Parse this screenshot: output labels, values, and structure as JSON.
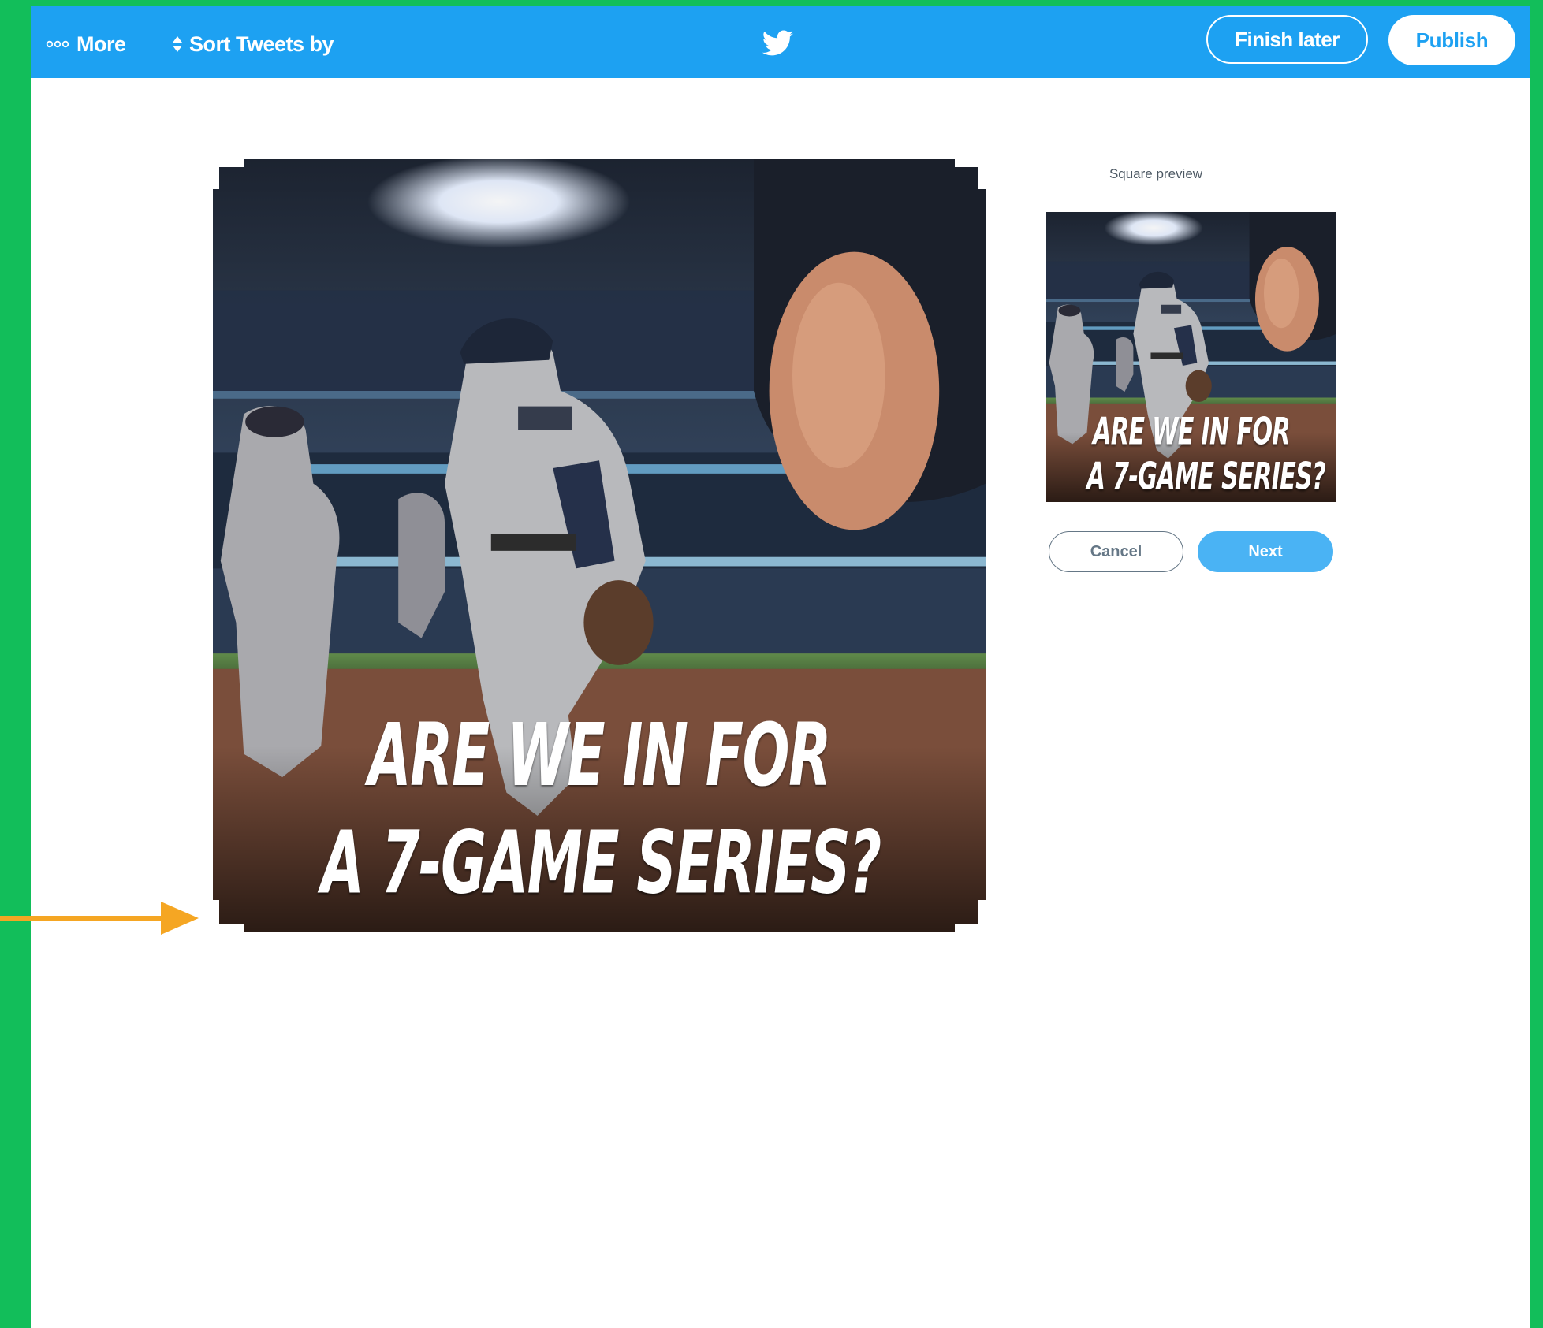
{
  "header": {
    "more_label": "More",
    "more_icon": "ellipsis-icon",
    "sort_label": "Sort Tweets by",
    "sort_icon": "sort-arrows-icon",
    "logo_icon": "twitter-bird-icon",
    "finish_later_label": "Finish later",
    "publish_label": "Publish"
  },
  "editor": {
    "caption_line1": "ARE WE IN FOR",
    "caption_line2": "A 7-GAME SERIES?"
  },
  "preview": {
    "label": "Square preview",
    "caption_line1": "ARE WE IN FOR",
    "caption_line2": "A 7-GAME SERIES?",
    "cancel_label": "Cancel",
    "next_label": "Next"
  },
  "annotation": {
    "arrow_icon": "arrow-right-icon",
    "arrow_color": "#f5a623"
  },
  "colors": {
    "brand": "#1da1f2",
    "next_button": "#4ab3f4",
    "background_frame": "#12be5a"
  }
}
